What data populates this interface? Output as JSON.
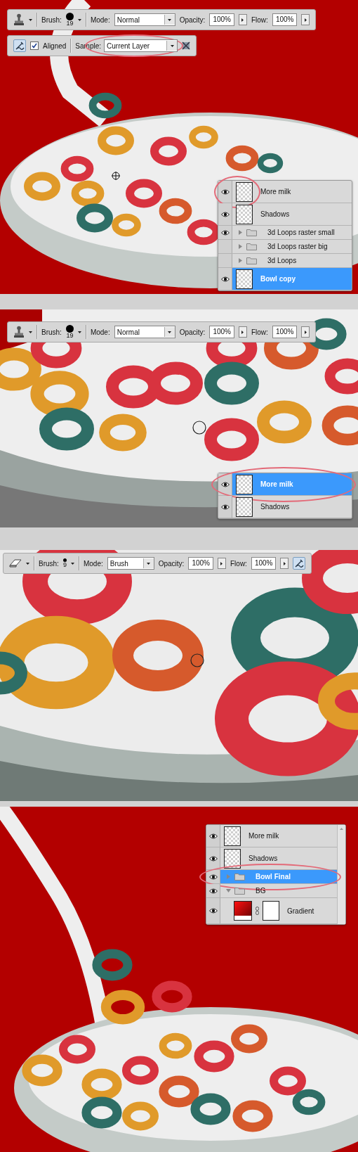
{
  "steps": [
    {
      "toolbar": {
        "kind": "clone-stamp",
        "brush_label": "Brush:",
        "brush_size": "19",
        "mode_label": "Mode:",
        "mode": "Normal",
        "opacity_label": "Opacity:",
        "opacity": "100%",
        "flow_label": "Flow:",
        "flow": "100%"
      },
      "options_bar": {
        "aligned_label": "Aligned",
        "aligned": true,
        "sample_label": "Sample:",
        "sample": "Current Layer",
        "sample_circled": true
      },
      "layers": [
        {
          "kind": "layer",
          "name": "More milk",
          "visible": true,
          "selected": false,
          "circled": true
        },
        {
          "kind": "layer",
          "name": "Shadows",
          "visible": true,
          "selected": false
        },
        {
          "kind": "group",
          "name": "3d Loops raster small",
          "visible": true,
          "selected": false,
          "expanded": false
        },
        {
          "kind": "group",
          "name": "3d Loops raster big",
          "visible": false,
          "selected": false,
          "expanded": false
        },
        {
          "kind": "group",
          "name": "3d Loops",
          "visible": false,
          "selected": false,
          "expanded": false
        },
        {
          "kind": "layer",
          "name": "Bowl copy",
          "visible": true,
          "selected": true
        }
      ]
    },
    {
      "toolbar": {
        "kind": "clone-stamp",
        "brush_label": "Brush:",
        "brush_size": "19",
        "mode_label": "Mode:",
        "mode": "Normal",
        "opacity_label": "Opacity:",
        "opacity": "100%",
        "flow_label": "Flow:",
        "flow": "100%"
      },
      "layers": [
        {
          "kind": "layer",
          "name": "More milk",
          "visible": true,
          "selected": true,
          "circled": true
        },
        {
          "kind": "layer",
          "name": "Shadows",
          "visible": true,
          "selected": false
        }
      ]
    },
    {
      "toolbar": {
        "kind": "eraser",
        "brush_label": "Brush:",
        "brush_size": "9",
        "mode_label": "Mode:",
        "mode": "Brush",
        "opacity_label": "Opacity:",
        "opacity": "100%",
        "flow_label": "Flow:",
        "flow": "100%",
        "airbrush": true
      }
    },
    {
      "layers": [
        {
          "kind": "layer",
          "name": "More milk",
          "visible": true,
          "selected": false
        },
        {
          "kind": "layer",
          "name": "Shadows",
          "visible": true,
          "selected": false
        },
        {
          "kind": "group",
          "name": "Bowl Final",
          "visible": true,
          "selected": true,
          "expanded": false,
          "circled": true
        },
        {
          "kind": "group",
          "name": "BG",
          "visible": true,
          "selected": false,
          "expanded": true,
          "children": [
            {
              "kind": "gradient-fill",
              "name": "Gradient",
              "visible": true,
              "selected": false
            }
          ]
        }
      ]
    }
  ]
}
